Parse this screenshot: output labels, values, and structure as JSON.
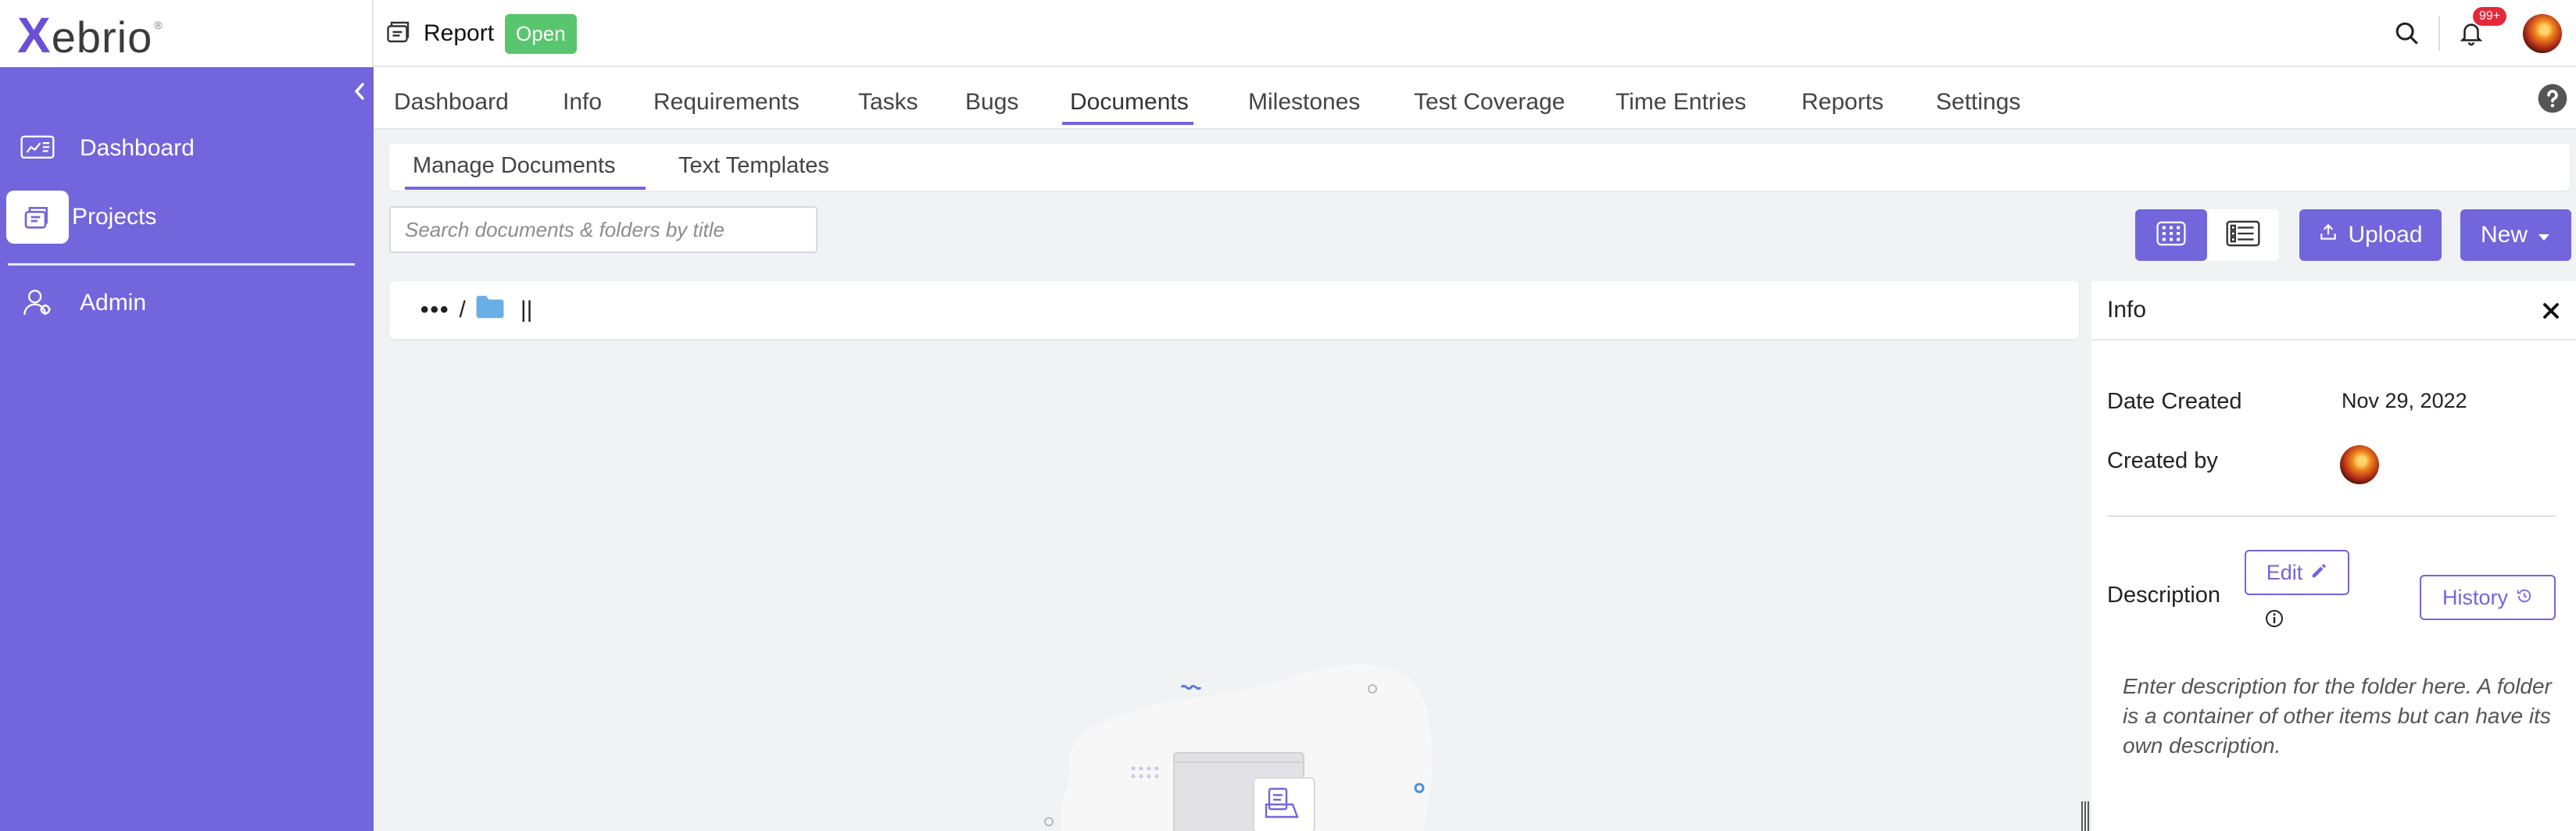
{
  "brand": {
    "logo_x": "X",
    "logo_rest": "ebrio",
    "registered": "®"
  },
  "header": {
    "project_name": "Report",
    "status": "Open",
    "notifications": "99+"
  },
  "sidebar": {
    "items": [
      {
        "label": "Dashboard",
        "icon": "dashboard-icon"
      },
      {
        "label": "Projects",
        "icon": "projects-icon",
        "active": true
      },
      {
        "label": "Admin",
        "icon": "admin-icon"
      }
    ]
  },
  "tabs": [
    "Dashboard",
    "Info",
    "Requirements",
    "Tasks",
    "Bugs",
    "Documents",
    "Milestones",
    "Test Coverage",
    "Time Entries",
    "Reports",
    "Settings"
  ],
  "active_tab": "Documents",
  "subtabs": [
    "Manage Documents",
    "Text Templates"
  ],
  "active_subtab": "Manage Documents",
  "search": {
    "placeholder": "Search documents & folders by title"
  },
  "toolbar": {
    "upload": "Upload",
    "new": "New"
  },
  "breadcrumb": {
    "ellipsis": "•••",
    "separator": "/",
    "folder": "||"
  },
  "info_panel": {
    "title": "Info",
    "date_created_label": "Date Created",
    "date_created_value": "Nov 29, 2022",
    "created_by_label": "Created by",
    "description_label": "Description",
    "edit_label": "Edit",
    "history_label": "History",
    "description_text": "Enter description for the folder here. A folder is a container of other items but can have its own description."
  },
  "colors": {
    "accent": "#7365dc",
    "open_badge": "#5ac56f",
    "notification_badge": "#e5293a"
  }
}
